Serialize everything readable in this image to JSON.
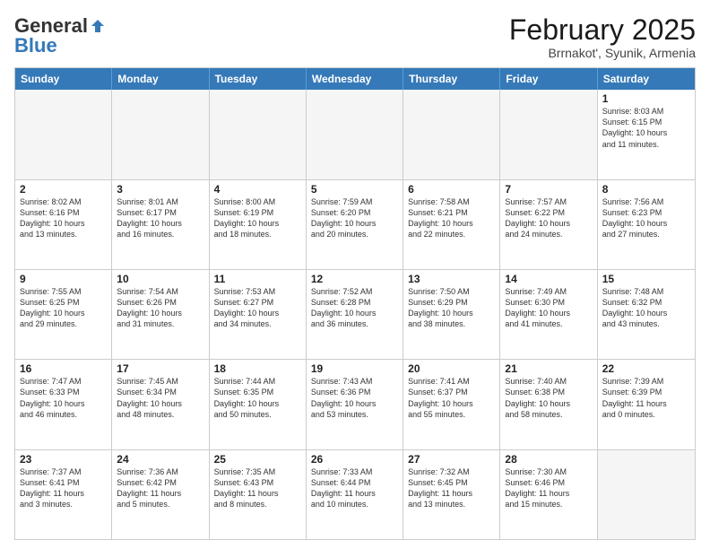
{
  "logo": {
    "line1": "General",
    "line2": "Blue"
  },
  "title": "February 2025",
  "location": "Brrnakot', Syunik, Armenia",
  "days": [
    "Sunday",
    "Monday",
    "Tuesday",
    "Wednesday",
    "Thursday",
    "Friday",
    "Saturday"
  ],
  "weeks": [
    [
      {
        "day": "",
        "info": ""
      },
      {
        "day": "",
        "info": ""
      },
      {
        "day": "",
        "info": ""
      },
      {
        "day": "",
        "info": ""
      },
      {
        "day": "",
        "info": ""
      },
      {
        "day": "",
        "info": ""
      },
      {
        "day": "1",
        "info": "Sunrise: 8:03 AM\nSunset: 6:15 PM\nDaylight: 10 hours\nand 11 minutes."
      }
    ],
    [
      {
        "day": "2",
        "info": "Sunrise: 8:02 AM\nSunset: 6:16 PM\nDaylight: 10 hours\nand 13 minutes."
      },
      {
        "day": "3",
        "info": "Sunrise: 8:01 AM\nSunset: 6:17 PM\nDaylight: 10 hours\nand 16 minutes."
      },
      {
        "day": "4",
        "info": "Sunrise: 8:00 AM\nSunset: 6:19 PM\nDaylight: 10 hours\nand 18 minutes."
      },
      {
        "day": "5",
        "info": "Sunrise: 7:59 AM\nSunset: 6:20 PM\nDaylight: 10 hours\nand 20 minutes."
      },
      {
        "day": "6",
        "info": "Sunrise: 7:58 AM\nSunset: 6:21 PM\nDaylight: 10 hours\nand 22 minutes."
      },
      {
        "day": "7",
        "info": "Sunrise: 7:57 AM\nSunset: 6:22 PM\nDaylight: 10 hours\nand 24 minutes."
      },
      {
        "day": "8",
        "info": "Sunrise: 7:56 AM\nSunset: 6:23 PM\nDaylight: 10 hours\nand 27 minutes."
      }
    ],
    [
      {
        "day": "9",
        "info": "Sunrise: 7:55 AM\nSunset: 6:25 PM\nDaylight: 10 hours\nand 29 minutes."
      },
      {
        "day": "10",
        "info": "Sunrise: 7:54 AM\nSunset: 6:26 PM\nDaylight: 10 hours\nand 31 minutes."
      },
      {
        "day": "11",
        "info": "Sunrise: 7:53 AM\nSunset: 6:27 PM\nDaylight: 10 hours\nand 34 minutes."
      },
      {
        "day": "12",
        "info": "Sunrise: 7:52 AM\nSunset: 6:28 PM\nDaylight: 10 hours\nand 36 minutes."
      },
      {
        "day": "13",
        "info": "Sunrise: 7:50 AM\nSunset: 6:29 PM\nDaylight: 10 hours\nand 38 minutes."
      },
      {
        "day": "14",
        "info": "Sunrise: 7:49 AM\nSunset: 6:30 PM\nDaylight: 10 hours\nand 41 minutes."
      },
      {
        "day": "15",
        "info": "Sunrise: 7:48 AM\nSunset: 6:32 PM\nDaylight: 10 hours\nand 43 minutes."
      }
    ],
    [
      {
        "day": "16",
        "info": "Sunrise: 7:47 AM\nSunset: 6:33 PM\nDaylight: 10 hours\nand 46 minutes."
      },
      {
        "day": "17",
        "info": "Sunrise: 7:45 AM\nSunset: 6:34 PM\nDaylight: 10 hours\nand 48 minutes."
      },
      {
        "day": "18",
        "info": "Sunrise: 7:44 AM\nSunset: 6:35 PM\nDaylight: 10 hours\nand 50 minutes."
      },
      {
        "day": "19",
        "info": "Sunrise: 7:43 AM\nSunset: 6:36 PM\nDaylight: 10 hours\nand 53 minutes."
      },
      {
        "day": "20",
        "info": "Sunrise: 7:41 AM\nSunset: 6:37 PM\nDaylight: 10 hours\nand 55 minutes."
      },
      {
        "day": "21",
        "info": "Sunrise: 7:40 AM\nSunset: 6:38 PM\nDaylight: 10 hours\nand 58 minutes."
      },
      {
        "day": "22",
        "info": "Sunrise: 7:39 AM\nSunset: 6:39 PM\nDaylight: 11 hours\nand 0 minutes."
      }
    ],
    [
      {
        "day": "23",
        "info": "Sunrise: 7:37 AM\nSunset: 6:41 PM\nDaylight: 11 hours\nand 3 minutes."
      },
      {
        "day": "24",
        "info": "Sunrise: 7:36 AM\nSunset: 6:42 PM\nDaylight: 11 hours\nand 5 minutes."
      },
      {
        "day": "25",
        "info": "Sunrise: 7:35 AM\nSunset: 6:43 PM\nDaylight: 11 hours\nand 8 minutes."
      },
      {
        "day": "26",
        "info": "Sunrise: 7:33 AM\nSunset: 6:44 PM\nDaylight: 11 hours\nand 10 minutes."
      },
      {
        "day": "27",
        "info": "Sunrise: 7:32 AM\nSunset: 6:45 PM\nDaylight: 11 hours\nand 13 minutes."
      },
      {
        "day": "28",
        "info": "Sunrise: 7:30 AM\nSunset: 6:46 PM\nDaylight: 11 hours\nand 15 minutes."
      },
      {
        "day": "",
        "info": ""
      }
    ]
  ]
}
